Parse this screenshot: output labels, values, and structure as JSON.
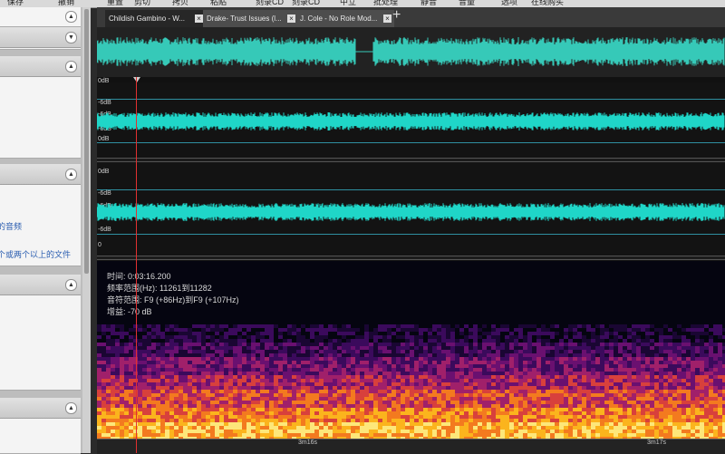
{
  "toolbar": {
    "items": [
      "保存",
      "撤销",
      "重置",
      "剪切",
      "拷贝",
      "粘贴",
      "刻录CD",
      "刻录CD",
      "中立",
      "批处理",
      "静音",
      "音量",
      "选项",
      "在线购买"
    ]
  },
  "sidebar": {
    "link_1": "的音频",
    "link_2": "个或两个以上的文件"
  },
  "tabs": [
    {
      "label": "Childish Gambino - W...",
      "close": "×"
    },
    {
      "label": "Drake- Trust Issues (l...",
      "close": "×"
    },
    {
      "label": "J. Cole - No Role Mod...",
      "close": "×"
    }
  ],
  "add_tab": "+",
  "tracks": {
    "labels": [
      "0dB",
      "-6dB",
      "-6dB",
      "-6dB",
      "0dB",
      "0dB",
      "-6dB",
      "-6dB",
      "-6dB",
      "0"
    ]
  },
  "info": {
    "time": "时间: 0:03:16.200",
    "freq": "频率范围(Hz): 11261到11282",
    "pitch": "音符范围: F9 (+86Hz)到F9 (+107Hz)",
    "gain": "增益: -70 dB"
  },
  "timeline": {
    "labels": [
      "3m16s",
      "3m17s"
    ]
  },
  "colors": {
    "waveform": "#1fd6c8",
    "overview_wave": "#36c9b8",
    "cursor": "#e23030"
  }
}
